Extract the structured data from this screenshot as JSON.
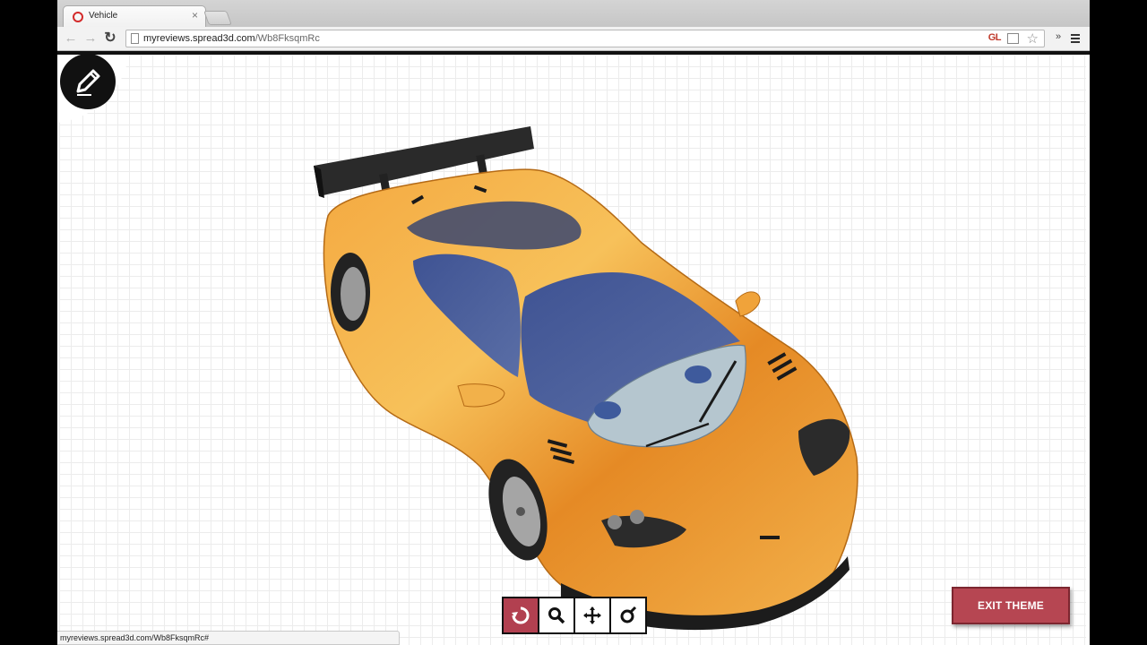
{
  "browser": {
    "tab": {
      "title": "Vehicle",
      "close": "×"
    },
    "url": {
      "domain": "myreviews.spread3d.com",
      "path": "/Wb8FksqmRc"
    },
    "extension_label": "GL",
    "overflow_label": "»",
    "status_url": "myreviews.spread3d.com/Wb8FksqmRc#"
  },
  "viewer": {
    "model": "orange supercar 3D model",
    "body_color": "#e8972f",
    "glass_color": "#4a5d98"
  },
  "toolbar": {
    "tools": [
      {
        "name": "rotate",
        "icon": "rotate-icon",
        "active": true
      },
      {
        "name": "zoom",
        "icon": "magnifier-icon",
        "active": false
      },
      {
        "name": "pan",
        "icon": "move-icon",
        "active": false
      },
      {
        "name": "reset",
        "icon": "orbit-reset-icon",
        "active": false
      }
    ],
    "active_color": "#b24050"
  },
  "exit_button": {
    "label": "EXIT THEME",
    "color": "#b64652"
  }
}
